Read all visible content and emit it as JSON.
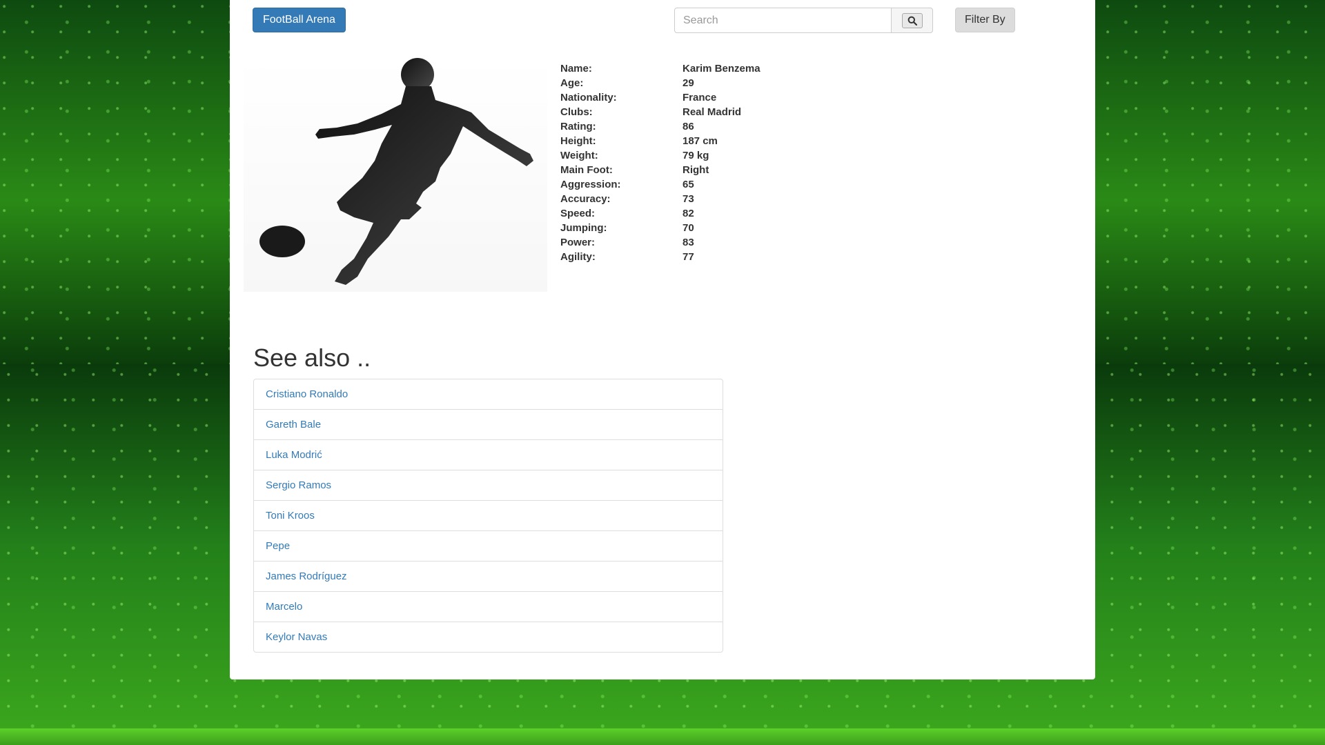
{
  "navbar": {
    "brand": "FootBall Arena",
    "search_placeholder": "Search",
    "filter_label": "Filter By"
  },
  "player": {
    "stats": [
      {
        "label": "Name:",
        "value": "Karim Benzema"
      },
      {
        "label": "Age:",
        "value": "29"
      },
      {
        "label": "Nationality:",
        "value": "France"
      },
      {
        "label": "Clubs:",
        "value": "Real Madrid"
      },
      {
        "label": "Rating:",
        "value": "86"
      },
      {
        "label": "Height:",
        "value": "187 cm"
      },
      {
        "label": "Weight:",
        "value": "79 kg"
      },
      {
        "label": "Main Foot:",
        "value": "Right"
      },
      {
        "label": "Aggression:",
        "value": "65"
      },
      {
        "label": "Accuracy:",
        "value": "73"
      },
      {
        "label": "Speed:",
        "value": "82"
      },
      {
        "label": "Jumping:",
        "value": "70"
      },
      {
        "label": "Power:",
        "value": "83"
      },
      {
        "label": "Agility:",
        "value": "77"
      }
    ]
  },
  "see_also": {
    "title": "See also ..",
    "items": [
      "Cristiano Ronaldo",
      "Gareth Bale",
      "Luka Modrić",
      "Sergio Ramos",
      "Toni Kroos",
      "Pepe",
      "James Rodríguez",
      "Marcelo",
      "Keylor Navas"
    ]
  },
  "colors": {
    "brand_button": "#337ab7",
    "link": "#337ab7",
    "background": "#1f6b13"
  },
  "icons": {
    "search": "search-icon",
    "player_silhouette": "player-silhouette-icon"
  }
}
